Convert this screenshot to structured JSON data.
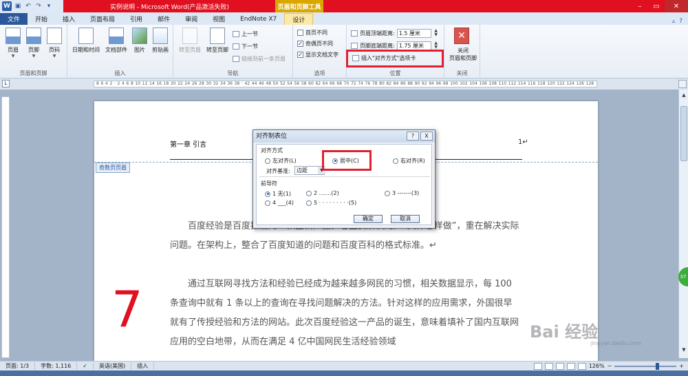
{
  "titlebar": {
    "title": "实例说明 - Microsoft Word(产品激活失败)",
    "contextual_title": "页眉和页脚工具",
    "logo": "W"
  },
  "tabs": [
    "文件",
    "开始",
    "插入",
    "页面布局",
    "引用",
    "邮件",
    "审阅",
    "视图",
    "EndNote X7",
    "设计"
  ],
  "ribbon": {
    "groups": {
      "header_footer": {
        "label": "页眉和页脚",
        "header": "页眉",
        "footer": "页脚",
        "page_number": "页码"
      },
      "insert": {
        "label": "插入",
        "datetime": "日期和时间",
        "docparts": "文档部件",
        "picture": "图片",
        "clipart": "剪贴画"
      },
      "navigation": {
        "label": "导航",
        "goto_header": "转至页眉",
        "goto_footer": "转至页脚",
        "prev": "上一节",
        "next": "下一节",
        "link_prev": "链接到前一条页眉"
      },
      "options": {
        "label": "选项",
        "first_page_diff": "首页不同",
        "odd_even_diff": "奇偶页不同",
        "show_doc_text": "显示文档文字"
      },
      "position": {
        "label": "位置",
        "header_top_label": "页眉顶端距离:",
        "header_top_value": "1.5 厘米",
        "footer_bottom_label": "页脚底端距离:",
        "footer_bottom_value": "1.75 厘米",
        "insert_align_tab": "插入\"对齐方式\"选项卡"
      },
      "close": {
        "label": "关闭",
        "close_btn": "关闭\n页眉和页脚"
      }
    }
  },
  "ruler": {
    "ticks": [
      "8",
      "6",
      "4",
      "2",
      "",
      "2",
      "4",
      "6",
      "8",
      "10",
      "12",
      "14",
      "16",
      "18",
      "20",
      "22",
      "24",
      "26",
      "28",
      "30",
      "32",
      "34",
      "36",
      "38",
      "",
      "42",
      "44",
      "46",
      "48",
      "50",
      "52",
      "54",
      "56",
      "58",
      "60",
      "62",
      "64",
      "66",
      "68",
      "70",
      "72",
      "74",
      "76",
      "78",
      "80",
      "82",
      "84",
      "86",
      "88",
      "90",
      "92",
      "94",
      "96",
      "98",
      "100",
      "102",
      "104",
      "106",
      "108",
      "110",
      "112",
      "114",
      "116",
      "118",
      "120",
      "122",
      "124",
      "126",
      "128"
    ]
  },
  "document": {
    "header_title": "第一章 引言",
    "page_number": "1↵",
    "odd_header_label": "奇数页页眉",
    "paragraphs": [
      "百度经验是百度推出的一款全新产品。它主要解决用户“具体怎样做”，重在解决实际问题。在架构上，整合了百度知道的问题和百度百科的格式标准。↵",
      "通过互联网寻找方法和经验已经成为越来越多网民的习惯，相关数据显示，每 100 条查询中就有 1 条以上的查询在寻找问题解决的方法。针对这样的应用需求，外国很早就有了传授经验和方法的网站。此次百度经验这一产品的诞生，意味着填补了国内互联网应用的空白地带，从而在满足 4 亿中国网民生活经验领域"
    ],
    "big_number": "7"
  },
  "dialog": {
    "title": "对齐制表位",
    "help": "?",
    "close": "X",
    "alignment_section": "对齐方式",
    "left": "左对齐(L)",
    "center": "居中(C)",
    "right": "右对齐(R)",
    "basis_label": "对齐基准:",
    "basis_value": "边距",
    "leader_section": "前导符",
    "leader1": "1 无(1)",
    "leader2": "2 .......(2)",
    "leader3": "3 -------(3)",
    "leader4": "4 ___(4)",
    "leader5": "5 · · · · · · · · ·(5)",
    "ok": "确定",
    "cancel": "取消"
  },
  "statusbar": {
    "page": "页面: 1/3",
    "words": "字数: 1,116",
    "lang": "英语(美国)",
    "mode": "插入",
    "zoom": "126%"
  },
  "badge": "37",
  "watermark": {
    "main": "Bai 经验",
    "sub": "jingyan.baidu.com"
  },
  "colors": {
    "accent": "#2b579a",
    "titlebar": "#e01020",
    "highlight_box": "#e0202e"
  }
}
